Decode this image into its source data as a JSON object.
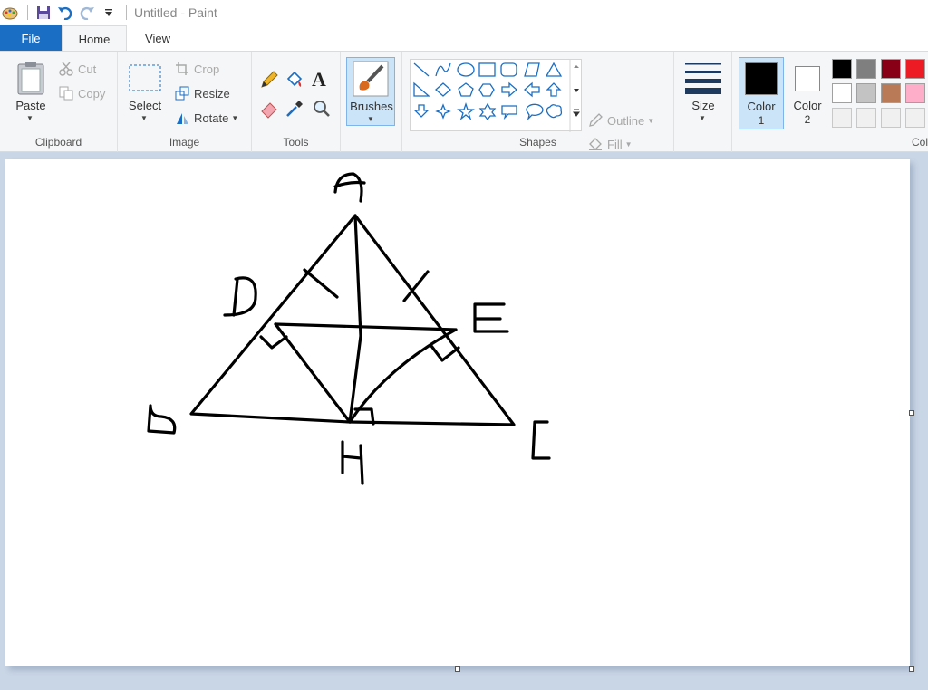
{
  "window": {
    "title": "Untitled - Paint"
  },
  "tabs": {
    "file": "File",
    "home": "Home",
    "view": "View"
  },
  "clipboard": {
    "paste": "Paste",
    "cut": "Cut",
    "copy": "Copy",
    "label": "Clipboard"
  },
  "image": {
    "select": "Select",
    "crop": "Crop",
    "resize": "Resize",
    "rotate": "Rotate",
    "label": "Image"
  },
  "tools": {
    "label": "Tools"
  },
  "brushes": {
    "label": "Brushes"
  },
  "shapes": {
    "outline": "Outline",
    "fill": "Fill",
    "label": "Shapes"
  },
  "size": {
    "label": "Size"
  },
  "color1": {
    "label": "Color",
    "num": "1",
    "value": "#000000"
  },
  "color2": {
    "label": "Color",
    "num": "2",
    "value": "#ffffff"
  },
  "colors": {
    "label": "Col",
    "row1": [
      "#000000",
      "#7f7f7f",
      "#880015",
      "#ed1c24"
    ],
    "row2": [
      "#ffffff",
      "#c3c3c3",
      "#b97a57",
      "#ffaec9"
    ],
    "row3": [
      "#f0f0f0",
      "#f0f0f0",
      "#f0f0f0",
      "#f0f0f0"
    ]
  },
  "accent": "#1a6fc4"
}
